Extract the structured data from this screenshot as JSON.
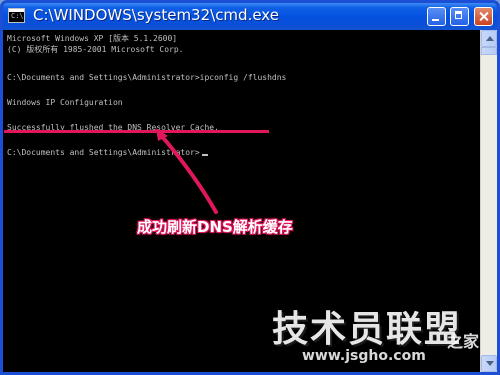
{
  "window": {
    "title": "C:\\WINDOWS\\system32\\cmd.exe",
    "icon_name": "cmd-icon",
    "icon_text": "C:\\",
    "controls": [
      "minimize-icon",
      "maximize-icon",
      "close-icon"
    ]
  },
  "console": {
    "lines": [
      "Microsoft Windows XP [版本 5.1.2600]",
      "(C) 版权所有 1985-2001 Microsoft Corp.",
      "",
      "C:\\Documents and Settings\\Administrator>ipconfig /flushdns",
      "",
      "Windows IP Configuration",
      "",
      "Successfully flushed the DNS Resolver Cache.",
      "",
      "C:\\Documents and Settings\\Administrator>"
    ]
  },
  "annotation": {
    "text": "成功刷新DNS解析缓存",
    "color": "#e0175a"
  },
  "watermark": {
    "main": "技术员联盟",
    "sub": "之家",
    "url": "www.jsgho.com"
  },
  "colors": {
    "titlebar": "#0551e0",
    "console_bg": "#000000",
    "console_text": "#c0c0c0",
    "accent": "#e0175a"
  }
}
